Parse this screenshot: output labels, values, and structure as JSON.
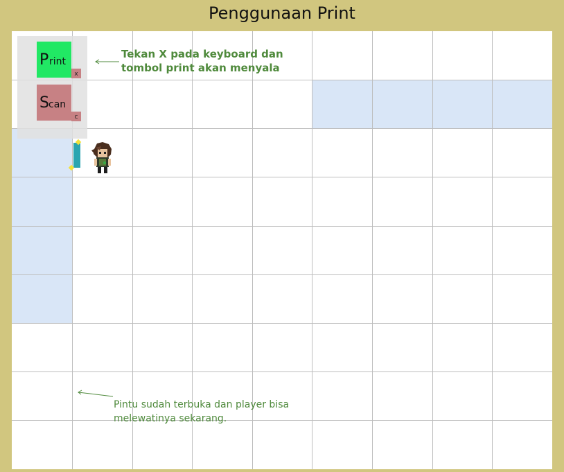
{
  "title": "Penggunaan Print",
  "buttons": {
    "print": {
      "big": "P",
      "small": "rint",
      "key": "X",
      "color": "#21e864",
      "key_color": "#c78184"
    },
    "scan": {
      "big": "S",
      "small": "can",
      "key": "C",
      "color": "#c78184",
      "key_color": "#c78184"
    }
  },
  "annotations": {
    "print_hint": "Tekan X pada keyboard dan tombol print akan menyala",
    "door_hint": "Pintu sudah terbuka dan player bisa melewatinya sekarang."
  },
  "colors": {
    "background": "#d1c67f",
    "highlight": "#d9e6f7",
    "note": "#4f8a3c",
    "door": "#2aa5b0",
    "sparkle": "#f2e23a"
  },
  "sprites": {
    "player": "player-character",
    "door": "door-open"
  }
}
